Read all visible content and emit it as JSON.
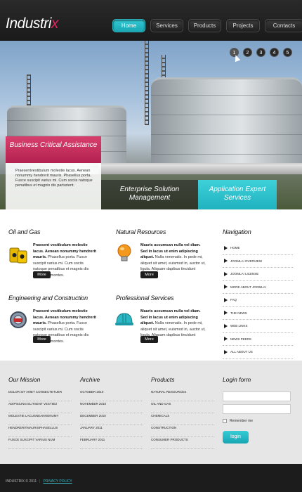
{
  "header": {
    "logo_main": "Industri",
    "logo_x": "x",
    "nav": [
      {
        "label": "Home"
      },
      {
        "label": "Services"
      },
      {
        "label": "Products"
      },
      {
        "label": "Projects"
      },
      {
        "label": "Contacts"
      }
    ]
  },
  "hero": {
    "slides": [
      "1",
      "2",
      "3",
      "4",
      "5"
    ],
    "caption_red": "Business Critical Assistance",
    "caption_text": "Praesentvestibulum molestie lacus. Aenean nonummy hendrerit mauris. Phasellus porta. Fusce suscipit varius mi. Cum sociis natoque penatibus et magnis dis parturient.",
    "caption_dark": "Enterprise Solution Management",
    "caption_teal": "Application Expert Services"
  },
  "features": [
    {
      "title": "Oil and Gas",
      "text_bold": "Praesent vestibulum molestie lacus. Aenean nonummy hendrerit mauris.",
      "text": "Phasellus porta. Fusce suscipit varius mi. Cum sociis natoque penatibus et magnis dis parturient montes.",
      "button": "More",
      "icon": "oil-barrels-icon"
    },
    {
      "title": "Natural Resources",
      "text_bold": "Mauris accumsan nulla vel diam. Sed in lacus ut enim adipiscing aliquet.",
      "text": "Nulla venenatis. In pede mi, aliquet sit amet, euismod in, auctor ut, ligula. Aliquam dapibus tincidunt metus.",
      "button": "More",
      "icon": "light-bulb-icon"
    },
    {
      "title": "Engineering and Construction",
      "text_bold": "Praesent vestibulum molestie lacus. Aenean nonummy hendrerit mauris.",
      "text": "Phasellus porta. Fusce suscipit varius mi. Cum sociis natoque penatibus et magnis dis parturient montes.",
      "button": "More",
      "icon": "engineering-gear-icon"
    },
    {
      "title": "Professional Services",
      "text_bold": "Mauris accumsan nulla vel diam. Sed in lacus ut enim adipiscing aliquet.",
      "text": "Nulla venenatis. In pede mi, aliquet sit amet, euismod in, auctor ut, ligula. Aliquam dapibus tincidunt metus.",
      "button": "More",
      "icon": "hard-hat-icon"
    }
  ],
  "navigation": {
    "title": "Navigation",
    "items": [
      "HOME",
      "JOOMLA! OVERVIEW",
      "JOOMLA! LICENSE",
      "MORE ABOUT JOOMLA!",
      "FAQ",
      "THE NEWS",
      "WEB LINKS",
      "NEWS FEEDS",
      "ALL ABOUT US"
    ]
  },
  "footer": {
    "mission": {
      "title": "Our Mission",
      "items": [
        "DOLOR SIT AMET CONSECTETUER",
        "ADIPISCING ELITSENT VESTIBU",
        "MOLESTIE LACUSNEANNONUMY",
        "HENDRERITMAURISPHASELLUS",
        "FUSCE SUSCIPIT VARIUS NUM"
      ]
    },
    "archive": {
      "title": "Archive",
      "items": [
        "OCTOBER 2010",
        "NOVEMBER 2010",
        "DECEMBER 2010",
        "JANUARY 2011",
        "FEBRUARY 2011"
      ]
    },
    "products": {
      "title": "Products",
      "items": [
        "NATURAL RESOURCES",
        "OIL AND GAS",
        "CHEMICALS",
        "CONSTRUCTION",
        "CONSUMER PRODUCTS"
      ]
    },
    "login": {
      "title": "Login form",
      "remember": "Remember me",
      "button": "login"
    }
  },
  "bottom": {
    "copyright": "INDUSTRIX © 2011",
    "separator": "|",
    "privacy": "PRIVACY POLICY"
  },
  "colors": {
    "accent_teal": "#1fb2bf",
    "accent_red": "#c42b5a",
    "dark": "#1c1c1c"
  }
}
